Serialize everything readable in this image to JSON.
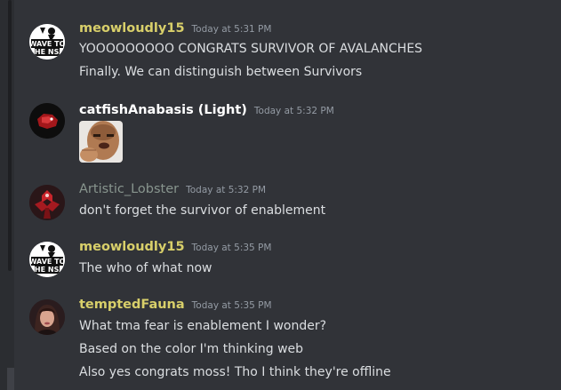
{
  "colors": {
    "background": "#313338",
    "text": "#dbdee1",
    "timestamp": "#949ba4",
    "meowloudly15": "#d8cf6a",
    "catfishAnabasis": "#ffffff",
    "artisticLobster": "#88958e",
    "temptedFauna": "#d8cf6a"
  },
  "messages": [
    {
      "username": "meowloudly15",
      "timestamp": "Today at 5:31 PM",
      "avatar_text": [
        "WAVE TO",
        "THE NSA"
      ],
      "lines": [
        "YOOOOOOOOO CONGRATS SURVIVOR OF AVALANCHES",
        "Finally. We can distinguish between Survivors"
      ]
    },
    {
      "username": "catfishAnabasis (Light)",
      "timestamp": "Today at 5:32 PM",
      "avatar_icon": "red-creature-icon",
      "attachment": "reaction-image"
    },
    {
      "username": "Artistic_Lobster",
      "timestamp": "Today at 5:32 PM",
      "avatar_icon": "red-figure-icon",
      "lines": [
        "don't forget the survivor of enablement"
      ]
    },
    {
      "username": "meowloudly15",
      "timestamp": "Today at 5:35 PM",
      "avatar_text": [
        "WAVE TO",
        "THE NSA"
      ],
      "lines": [
        "The who of what now"
      ]
    },
    {
      "username": "temptedFauna",
      "timestamp": "Today at 5:35 PM",
      "avatar_icon": "portrait-icon",
      "lines": [
        "What tma fear is enablement I wonder?",
        "Based on the color I'm thinking web",
        "Also yes congrats moss! Tho I think they're offline"
      ]
    }
  ]
}
